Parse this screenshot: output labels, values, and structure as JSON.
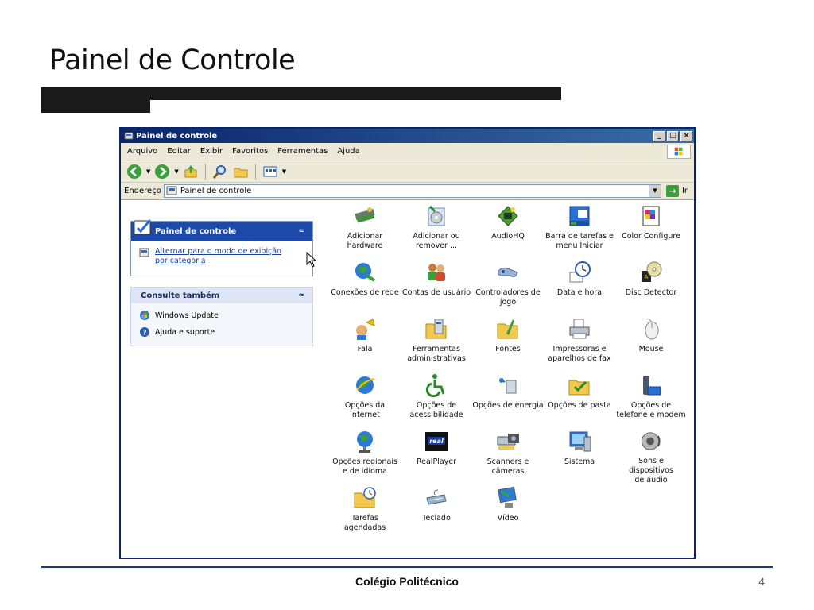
{
  "slide": {
    "title": "Painel de Controle",
    "footer": "Colégio Politécnico",
    "page_number": "4"
  },
  "window": {
    "title": "Painel de controle",
    "menu": [
      "Arquivo",
      "Editar",
      "Exibir",
      "Favoritos",
      "Ferramentas",
      "Ajuda"
    ],
    "address_label": "Endereço",
    "address_value": "Painel de controle",
    "go_label": "Ir"
  },
  "task_panel": {
    "title": "Painel de controle",
    "link": "Alternar para o modo de exibição por categoria"
  },
  "see_also": {
    "title": "Consulte também",
    "items": [
      "Windows Update",
      "Ajuda e suporte"
    ]
  },
  "icons": [
    {
      "label": "Adicionar\nhardware",
      "icon": "hardware-icon"
    },
    {
      "label": "Adicionar ou\nremover ...",
      "icon": "add-remove-icon"
    },
    {
      "label": "AudioHQ",
      "icon": "audiohq-icon"
    },
    {
      "label": "Barra de tarefas e\nmenu Iniciar",
      "icon": "taskbar-icon"
    },
    {
      "label": "Color Configure",
      "icon": "color-icon"
    },
    {
      "label": "Conexões de rede",
      "icon": "network-icon"
    },
    {
      "label": "Contas de usuário",
      "icon": "users-icon"
    },
    {
      "label": "Controladores de\njogo",
      "icon": "gamepad-icon"
    },
    {
      "label": "Data e hora",
      "icon": "clock-icon"
    },
    {
      "label": "Disc Detector",
      "icon": "disc-icon"
    },
    {
      "label": "Fala",
      "icon": "speech-icon"
    },
    {
      "label": "Ferramentas\nadministrativas",
      "icon": "admin-tools-icon"
    },
    {
      "label": "Fontes",
      "icon": "fonts-folder-icon"
    },
    {
      "label": "Impressoras e\naparelhos de fax",
      "icon": "printer-icon"
    },
    {
      "label": "Mouse",
      "icon": "mouse-icon"
    },
    {
      "label": "Opções da\nInternet",
      "icon": "internet-icon"
    },
    {
      "label": "Opções de\nacessibilidade",
      "icon": "accessibility-icon"
    },
    {
      "label": "Opções de energia",
      "icon": "power-icon"
    },
    {
      "label": "Opções de pasta",
      "icon": "folder-options-icon"
    },
    {
      "label": "Opções de\ntelefone e modem",
      "icon": "phone-icon"
    },
    {
      "label": "Opções regionais\ne de idioma",
      "icon": "globe-icon"
    },
    {
      "label": "RealPlayer",
      "icon": "realplayer-icon"
    },
    {
      "label": "Scanners e\ncâmeras",
      "icon": "scanner-icon"
    },
    {
      "label": "Sistema",
      "icon": "system-icon"
    },
    {
      "label": "Sons e dispositivos\nde áudio",
      "icon": "speaker-icon"
    },
    {
      "label": "Tarefas\nagendadas",
      "icon": "scheduled-tasks-icon"
    },
    {
      "label": "Teclado",
      "icon": "keyboard-icon"
    },
    {
      "label": "Vídeo",
      "icon": "display-icon"
    }
  ]
}
